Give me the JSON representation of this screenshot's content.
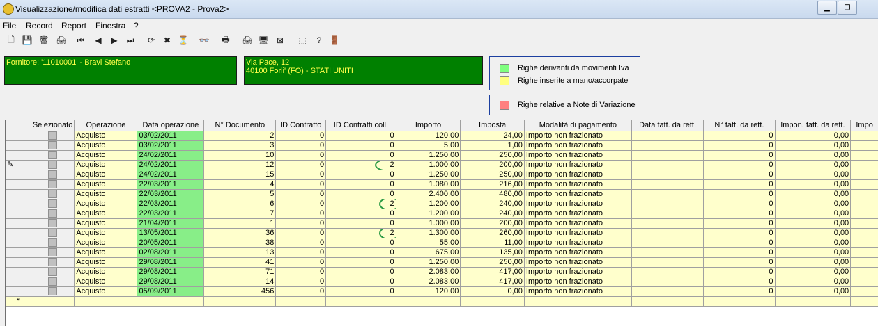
{
  "window": {
    "title": "Visualizzazione/modifica dati estratti <PROVA2 - Prova2>"
  },
  "menu": [
    "File",
    "Record",
    "Report",
    "Finestra",
    "?"
  ],
  "supplier": {
    "name": "Fornitore: '11010001' - Bravi Stefano",
    "address_line1": "Via Pace, 12",
    "address_line2": "40100 Forli' (FO) - STATI UNITI"
  },
  "legend": {
    "items": [
      {
        "label": "Righe derivanti da movimenti Iva",
        "color": "#80ff80"
      },
      {
        "label": "Righe inserite a mano/accorpate",
        "color": "#ffff80"
      }
    ],
    "note": {
      "label": "Righe relative a Note di Variazione",
      "color": "#ff8080"
    }
  },
  "table": {
    "columns": [
      "Selezionato",
      "Operazione",
      "Data operazione",
      "N° Documento",
      "ID Contratto",
      "ID Contratti coll.",
      "Importo",
      "Imposta",
      "Modalità di pagamento",
      "Data fatt. da rett.",
      "N° fatt. da rett.",
      "Impon. fatt. da rett.",
      "Impo"
    ],
    "rows": [
      [
        "Acquisto",
        "03/02/2011",
        "2",
        "0",
        "0",
        "120,00",
        "24,00",
        "Importo non frazionato",
        "",
        "0",
        "0,00"
      ],
      [
        "Acquisto",
        "03/02/2011",
        "3",
        "0",
        "0",
        "5,00",
        "1,00",
        "Importo non frazionato",
        "",
        "0",
        "0,00"
      ],
      [
        "Acquisto",
        "24/02/2011",
        "10",
        "0",
        "0",
        "1.250,00",
        "250,00",
        "Importo non frazionato",
        "",
        "0",
        "0,00"
      ],
      [
        "Acquisto",
        "24/02/2011",
        "12",
        "0",
        "2",
        "1.000,00",
        "200,00",
        "Importo non frazionato",
        "",
        "0",
        "0,00"
      ],
      [
        "Acquisto",
        "24/02/2011",
        "15",
        "0",
        "0",
        "1.250,00",
        "250,00",
        "Importo non frazionato",
        "",
        "0",
        "0,00"
      ],
      [
        "Acquisto",
        "22/03/2011",
        "4",
        "0",
        "0",
        "1.080,00",
        "216,00",
        "Importo non frazionato",
        "",
        "0",
        "0,00"
      ],
      [
        "Acquisto",
        "22/03/2011",
        "5",
        "0",
        "0",
        "2.400,00",
        "480,00",
        "Importo non frazionato",
        "",
        "0",
        "0,00"
      ],
      [
        "Acquisto",
        "22/03/2011",
        "6",
        "0",
        "2",
        "1.200,00",
        "240,00",
        "Importo non frazionato",
        "",
        "0",
        "0,00"
      ],
      [
        "Acquisto",
        "22/03/2011",
        "7",
        "0",
        "0",
        "1.200,00",
        "240,00",
        "Importo non frazionato",
        "",
        "0",
        "0,00"
      ],
      [
        "Acquisto",
        "21/04/2011",
        "1",
        "0",
        "0",
        "1.000,00",
        "200,00",
        "Importo non frazionato",
        "",
        "0",
        "0,00"
      ],
      [
        "Acquisto",
        "13/05/2011",
        "36",
        "0",
        "2",
        "1.300,00",
        "260,00",
        "Importo non frazionato",
        "",
        "0",
        "0,00"
      ],
      [
        "Acquisto",
        "20/05/2011",
        "38",
        "0",
        "0",
        "55,00",
        "11,00",
        "Importo non frazionato",
        "",
        "0",
        "0,00"
      ],
      [
        "Acquisto",
        "02/08/2011",
        "13",
        "0",
        "0",
        "675,00",
        "135,00",
        "Importo non frazionato",
        "",
        "0",
        "0,00"
      ],
      [
        "Acquisto",
        "29/08/2011",
        "41",
        "0",
        "0",
        "1.250,00",
        "250,00",
        "Importo non frazionato",
        "",
        "0",
        "0,00"
      ],
      [
        "Acquisto",
        "29/08/2011",
        "71",
        "0",
        "0",
        "2.083,00",
        "417,00",
        "Importo non frazionato",
        "",
        "0",
        "0,00"
      ],
      [
        "Acquisto",
        "29/08/2011",
        "14",
        "0",
        "0",
        "2.083,00",
        "417,00",
        "Importo non frazionato",
        "",
        "0",
        "0,00"
      ],
      [
        "Acquisto",
        "05/09/2011",
        "456",
        "0",
        "0",
        "120,00",
        "0,00",
        "Importo non frazionato",
        "",
        "0",
        "0,00"
      ]
    ],
    "current_row_index": 3,
    "circled_rows": [
      3,
      7,
      10
    ],
    "current_row_marker": "✎",
    "new_row_marker": "*"
  }
}
